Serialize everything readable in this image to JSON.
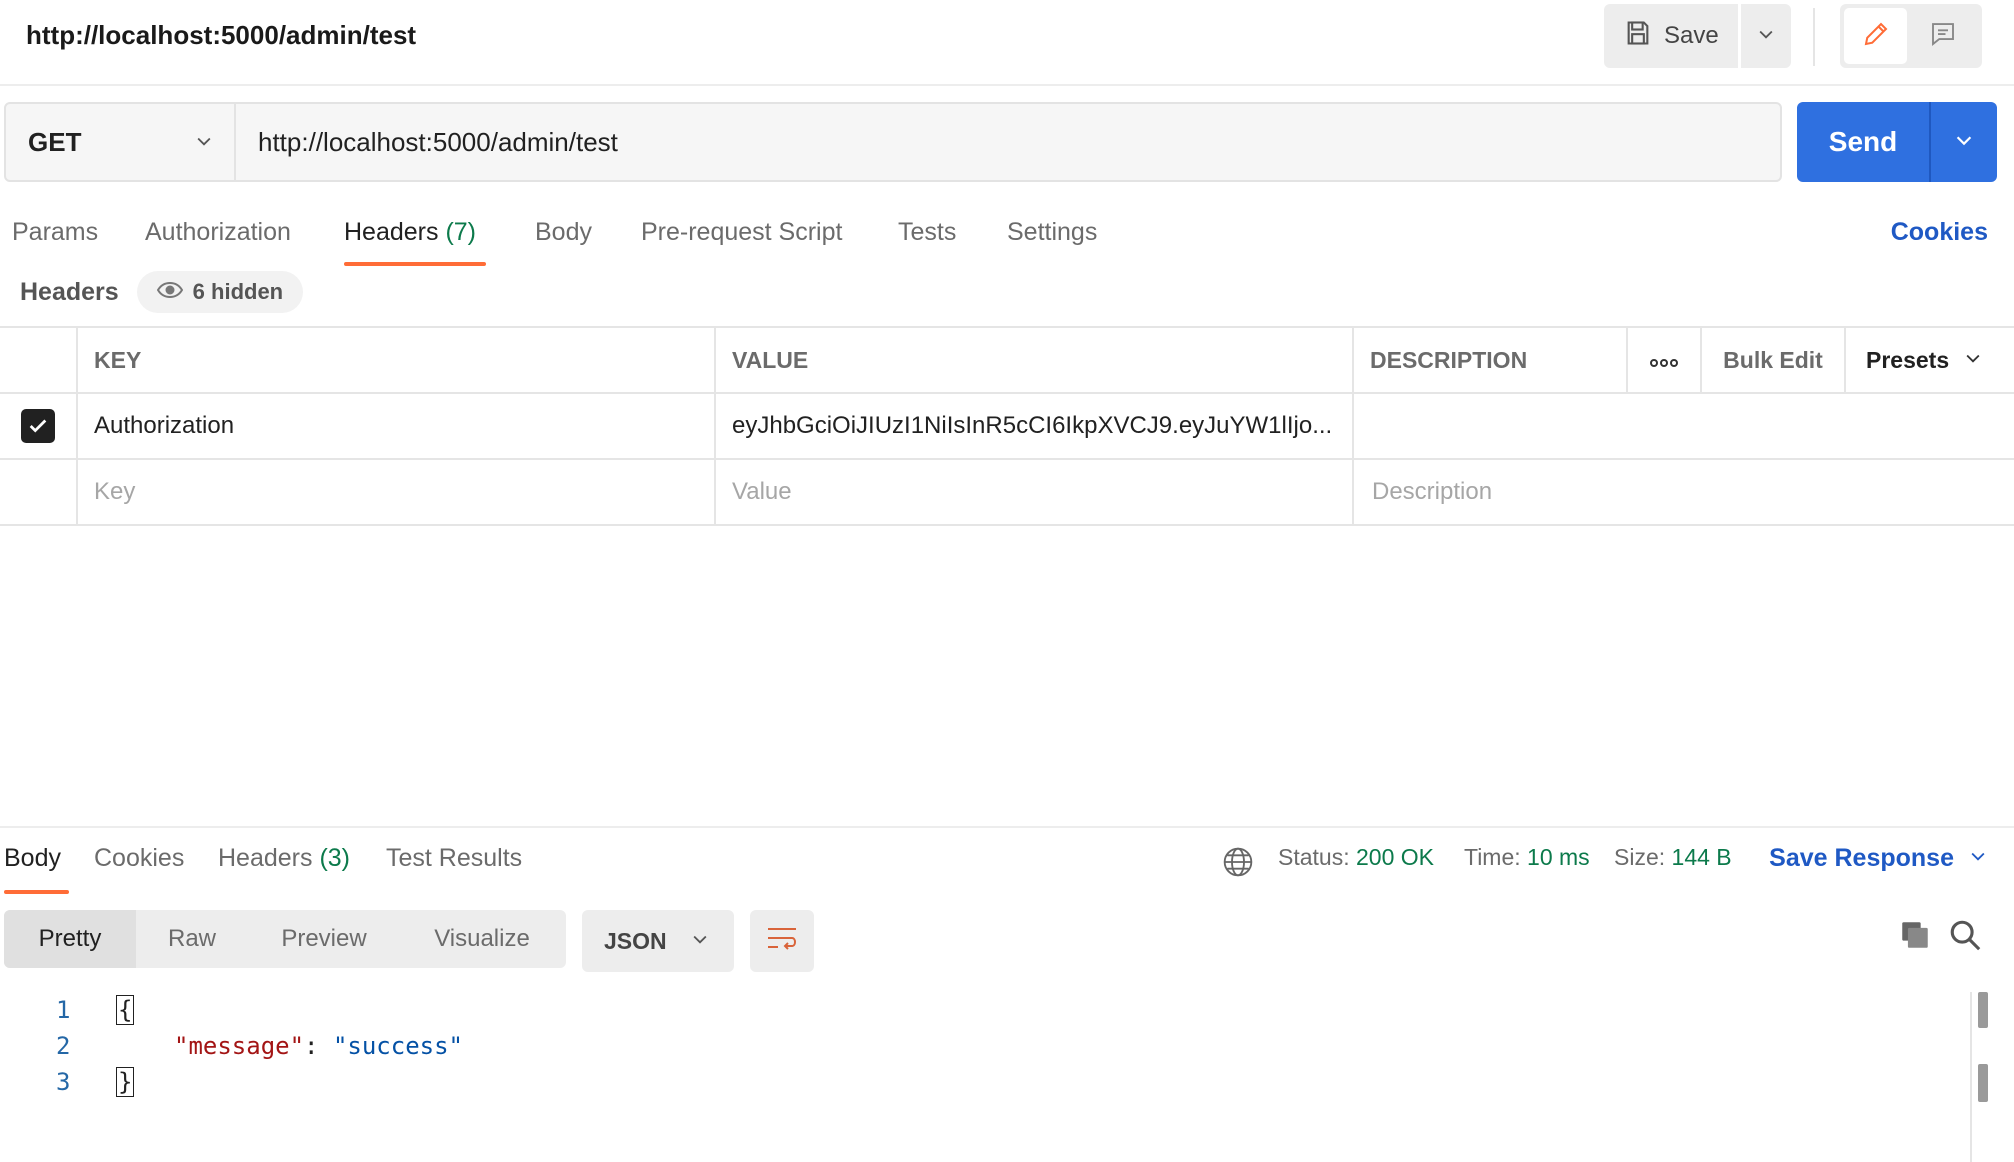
{
  "title_bar": {
    "title": "http://localhost:5000/admin/test",
    "save_label": "Save"
  },
  "request": {
    "method": "GET",
    "url": "http://localhost:5000/admin/test",
    "send_label": "Send"
  },
  "request_tabs": {
    "params": "Params",
    "authorization": "Authorization",
    "headers": "Headers",
    "headers_count": "(7)",
    "body": "Body",
    "pre_request": "Pre-request Script",
    "tests": "Tests",
    "settings": "Settings",
    "cookies": "Cookies"
  },
  "headers_section": {
    "title": "Headers",
    "hidden_label": "6 hidden",
    "columns": {
      "key": "KEY",
      "value": "VALUE",
      "description": "DESCRIPTION",
      "bulk_edit": "Bulk Edit",
      "presets": "Presets"
    },
    "rows": [
      {
        "checked": true,
        "key": "Authorization",
        "value": "eyJhbGciOiJIUzI1NiIsInR5cCI6IkpXVCJ9.eyJuYW1lIjo...",
        "description": ""
      }
    ],
    "placeholder": {
      "key": "Key",
      "value": "Value",
      "description": "Description"
    }
  },
  "response_tabs": {
    "body": "Body",
    "cookies": "Cookies",
    "headers": "Headers",
    "headers_count": "(3)",
    "test_results": "Test Results"
  },
  "response_meta": {
    "status_label": "Status:",
    "status_value": "200 OK",
    "time_label": "Time:",
    "time_value": "10 ms",
    "size_label": "Size:",
    "size_value": "144 B",
    "save_response": "Save Response"
  },
  "response_view": {
    "modes": [
      "Pretty",
      "Raw",
      "Preview",
      "Visualize"
    ],
    "active_mode": "Pretty",
    "format": "JSON"
  },
  "response_body": {
    "line_numbers": [
      "1",
      "2",
      "3"
    ],
    "open_brace": "{",
    "key": "\"message\"",
    "colon": ": ",
    "value": "\"success\"",
    "close_brace": "}"
  },
  "colors": {
    "accent_orange": "#ff6c37",
    "send_blue": "#2f70e0",
    "link_blue": "#1f59c4",
    "success_green": "#0c7a4b"
  },
  "icons": [
    "save-icon",
    "chevron-down-icon",
    "edit-pencil-icon",
    "comment-icon",
    "eye-icon",
    "more-options-icon",
    "check-icon",
    "globe-icon",
    "wrap-lines-icon",
    "copy-icon",
    "search-icon"
  ]
}
